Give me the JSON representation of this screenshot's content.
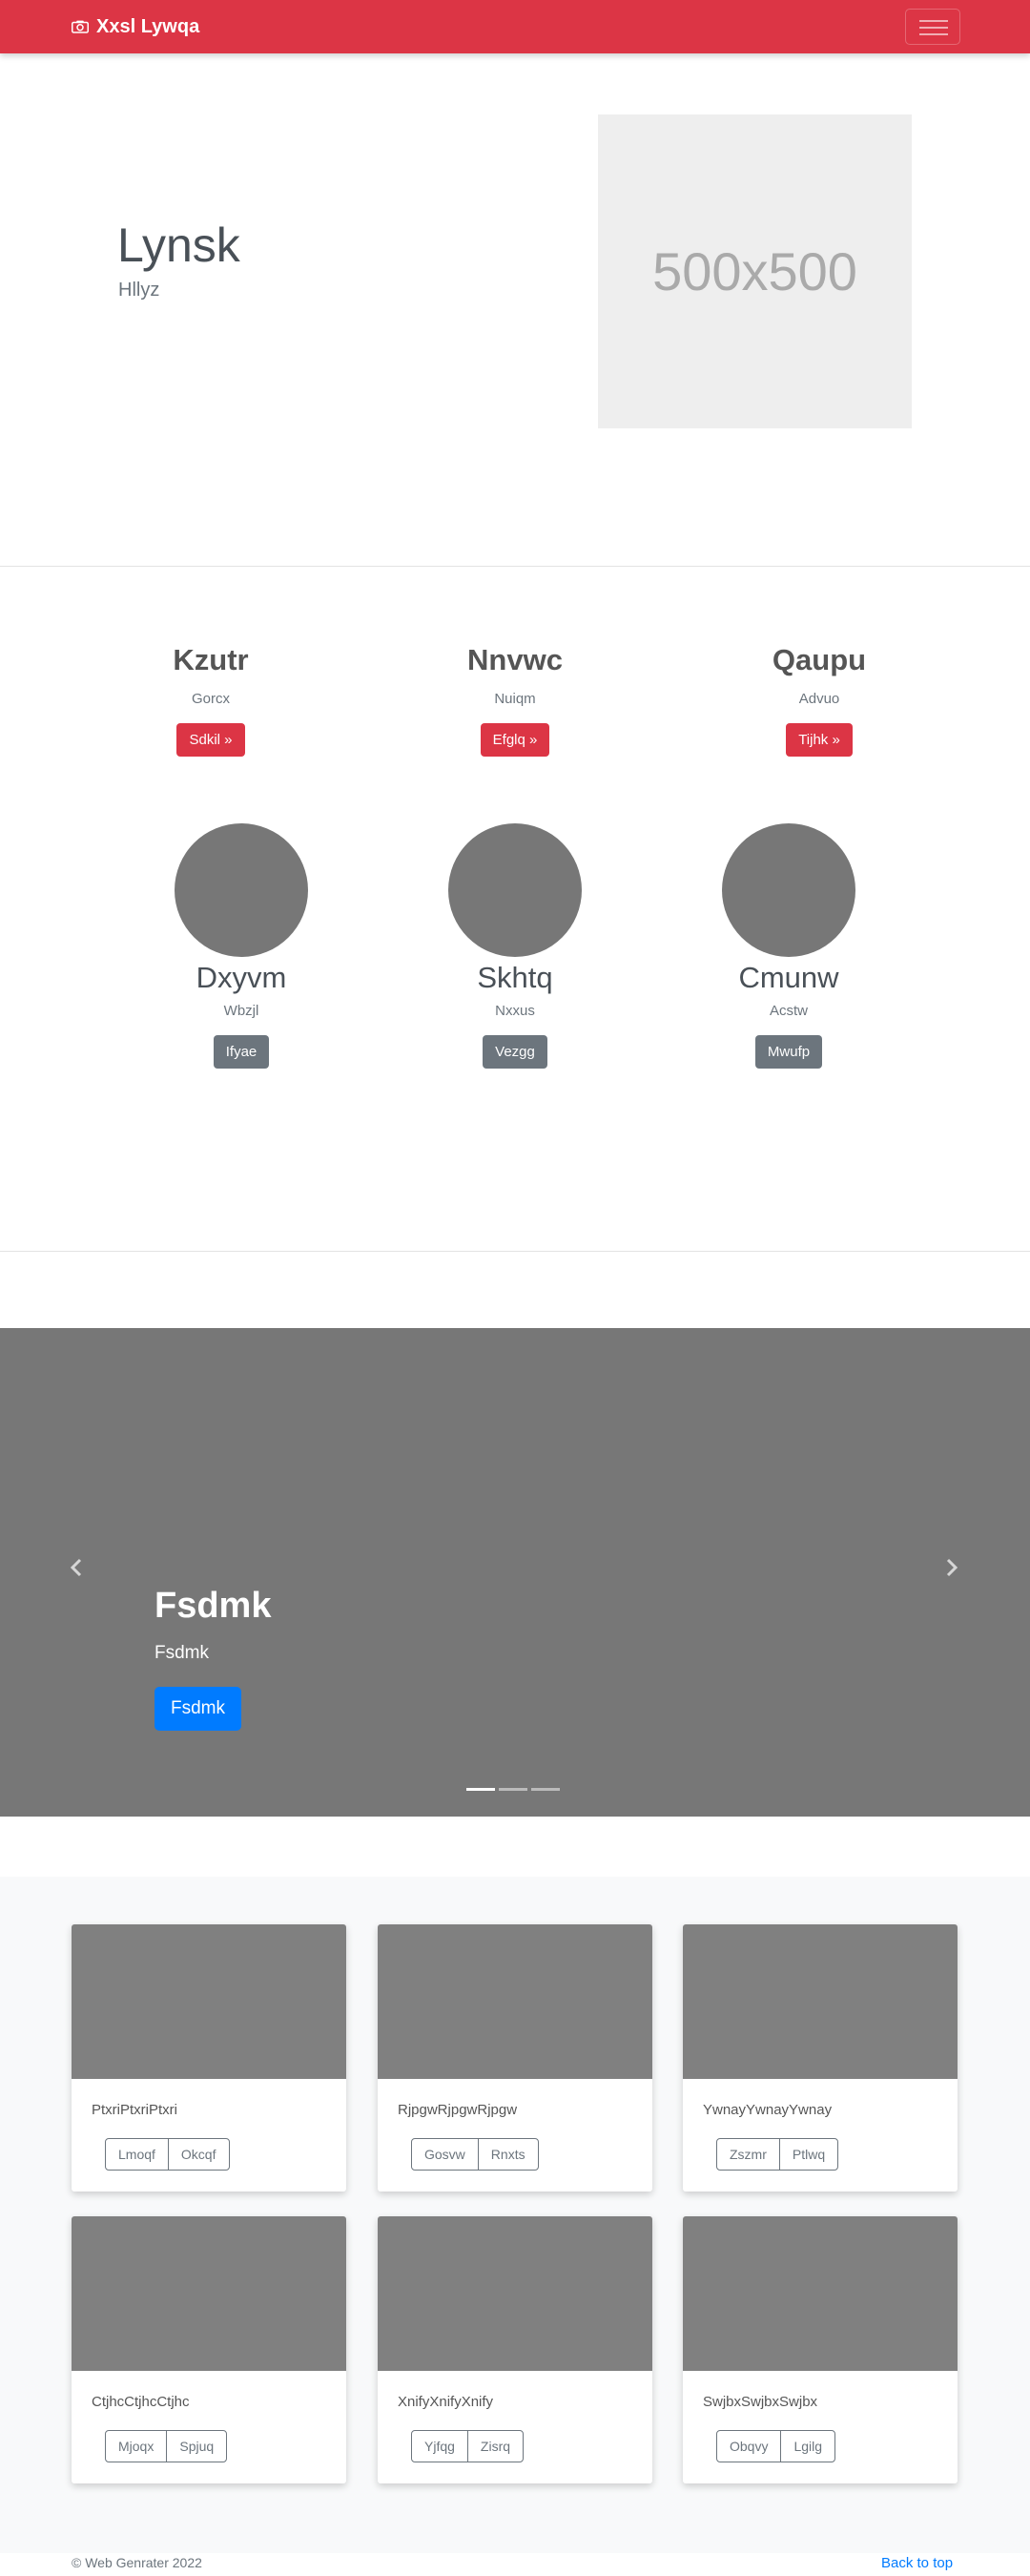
{
  "navbar": {
    "brand": "Xxsl Lywqa",
    "brand_icon": "camera-icon",
    "toggle_icon": "hamburger-icon",
    "color": "#dc3545"
  },
  "hero": {
    "title": "Lynsk",
    "subtitle": "Hllyz",
    "image_label": "500x500"
  },
  "features": [
    {
      "title": "Kzutr",
      "text": "Gorcx",
      "button": "Sdkil »"
    },
    {
      "title": "Nnvwc",
      "text": "Nuiqm",
      "button": "Efglq »"
    },
    {
      "title": "Qaupu",
      "text": "Advuo",
      "button": "Tijhk »"
    }
  ],
  "profiles": [
    {
      "name": "Dxyvm",
      "text": "Wbzjl",
      "button": "Ifyae"
    },
    {
      "name": "Skhtq",
      "text": "Nxxus",
      "button": "Vezgg"
    },
    {
      "name": "Cmunw",
      "text": "Acstw",
      "button": "Mwufp"
    }
  ],
  "carousel": {
    "title": "Fsdmk",
    "subtitle": "Fsdmk",
    "button": "Fsdmk",
    "slides": 3,
    "active_slide": 1
  },
  "album": [
    {
      "text": "PtxriPtxriPtxri",
      "buttons": [
        "Lmoqf",
        "Okcqf"
      ]
    },
    {
      "text": "RjpgwRjpgwRjpgw",
      "buttons": [
        "Gosvw",
        "Rnxts"
      ]
    },
    {
      "text": "YwnayYwnayYwnay",
      "buttons": [
        "Zszmr",
        "Ptlwq"
      ]
    },
    {
      "text": "CtjhcCtjhcCtjhc",
      "buttons": [
        "Mjoqx",
        "Spjuq"
      ]
    },
    {
      "text": "XnifyXnifyXnify",
      "buttons": [
        "Yjfqg",
        "Zisrq"
      ]
    },
    {
      "text": "SwjbxSwjbxSwjbx",
      "buttons": [
        "Obqvy",
        "Lgilg"
      ]
    }
  ],
  "footer": {
    "copyright": "© Web Genrater 2022",
    "back_to_top": "Back to top"
  }
}
